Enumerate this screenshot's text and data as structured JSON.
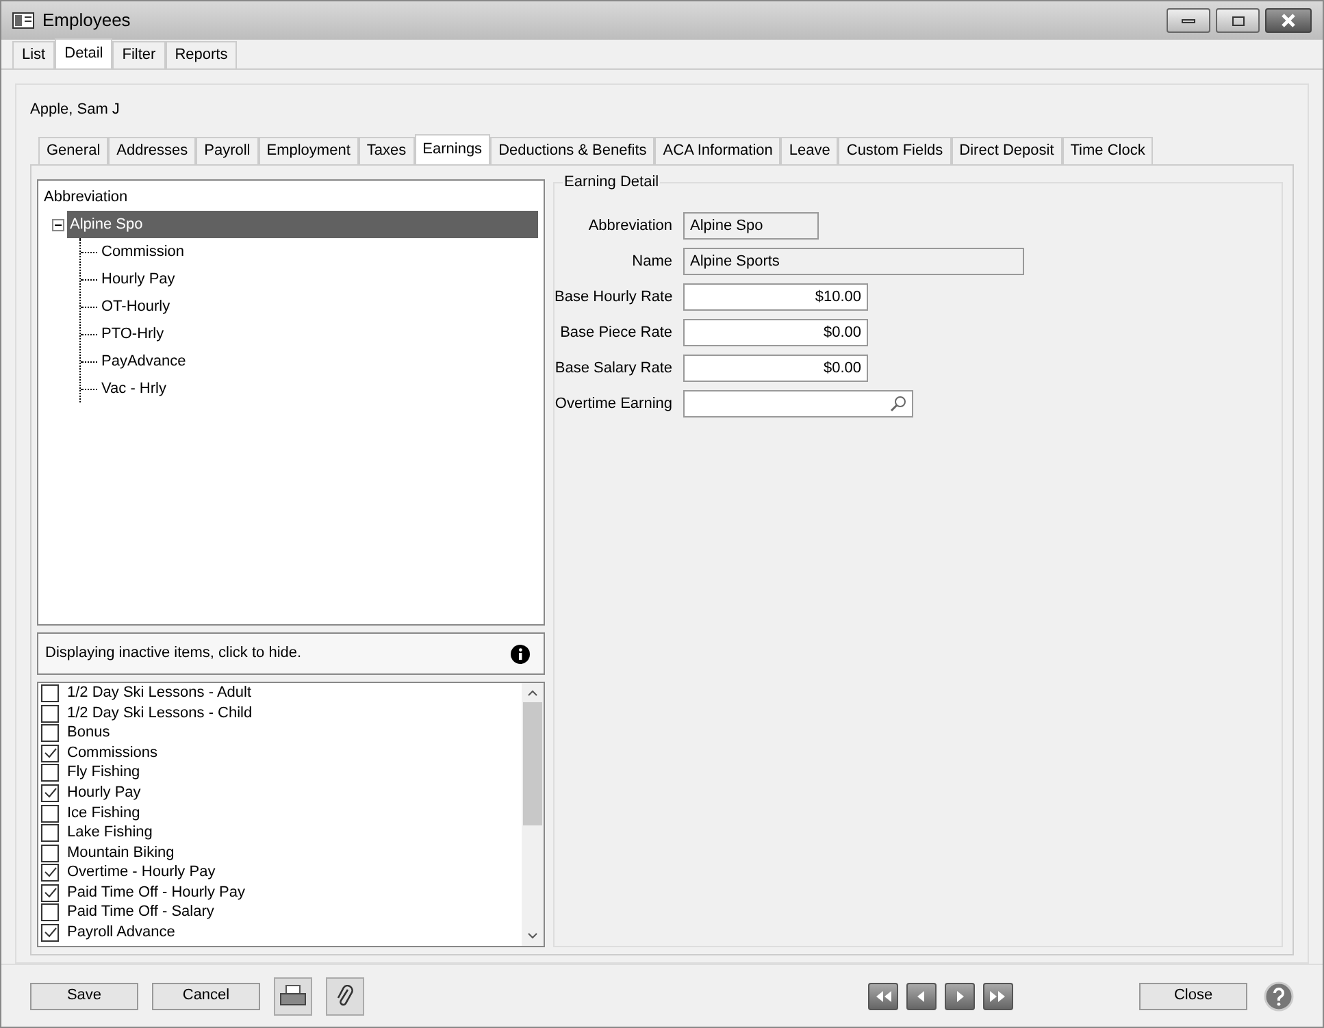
{
  "window": {
    "title": "Employees"
  },
  "tabs": [
    {
      "label": "List",
      "selected": false
    },
    {
      "label": "Detail",
      "selected": true
    },
    {
      "label": "Filter",
      "selected": false
    },
    {
      "label": "Reports",
      "selected": false
    }
  ],
  "employee_name": "Apple, Sam J",
  "detail_tabs": [
    {
      "label": "General",
      "selected": false
    },
    {
      "label": "Addresses",
      "selected": false
    },
    {
      "label": "Payroll",
      "selected": false
    },
    {
      "label": "Employment",
      "selected": false
    },
    {
      "label": "Taxes",
      "selected": false
    },
    {
      "label": "Earnings",
      "selected": true
    },
    {
      "label": "Deductions & Benefits",
      "selected": false
    },
    {
      "label": "ACA Information",
      "selected": false
    },
    {
      "label": "Leave",
      "selected": false
    },
    {
      "label": "Custom Fields",
      "selected": false
    },
    {
      "label": "Direct Deposit",
      "selected": false
    },
    {
      "label": "Time Clock",
      "selected": false
    }
  ],
  "tree": {
    "header": "Abbreviation",
    "items": [
      {
        "label": "Alpine Spo",
        "selected": true,
        "expanded": true,
        "children": [
          {
            "label": "Commission",
            "selected": false
          },
          {
            "label": "Hourly Pay",
            "selected": false
          },
          {
            "label": "OT-Hourly",
            "selected": false
          },
          {
            "label": "PTO-Hrly",
            "selected": false
          },
          {
            "label": "PayAdvance",
            "selected": false
          },
          {
            "label": "Vac - Hrly",
            "selected": false
          }
        ]
      }
    ]
  },
  "inactive_notice": "Displaying inactive items, click to hide.",
  "earnings_list": [
    {
      "label": "1/2 Day Ski Lessons - Adult",
      "checked": false
    },
    {
      "label": "1/2 Day Ski Lessons - Child",
      "checked": false
    },
    {
      "label": "Bonus",
      "checked": false
    },
    {
      "label": "Commissions",
      "checked": true
    },
    {
      "label": "Fly Fishing",
      "checked": false
    },
    {
      "label": "Hourly Pay",
      "checked": true
    },
    {
      "label": "Ice Fishing",
      "checked": false
    },
    {
      "label": "Lake Fishing",
      "checked": false
    },
    {
      "label": "Mountain Biking",
      "checked": false
    },
    {
      "label": "Overtime - Hourly Pay",
      "checked": true
    },
    {
      "label": "Paid Time Off - Hourly Pay",
      "checked": true
    },
    {
      "label": "Paid Time Off - Salary",
      "checked": false
    },
    {
      "label": "Payroll Advance",
      "checked": true
    }
  ],
  "earning_detail": {
    "title": "Earning Detail",
    "fields": [
      {
        "label": "Abbreviation",
        "value": "Alpine Spo",
        "kind": "readonly"
      },
      {
        "label": "Name",
        "value": "Alpine Sports",
        "kind": "readonly"
      },
      {
        "label": "Base Hourly Rate",
        "value": "$10.00",
        "kind": "amount"
      },
      {
        "label": "Base Piece Rate",
        "value": "$0.00",
        "kind": "amount"
      },
      {
        "label": "Base Salary Rate",
        "value": "$0.00",
        "kind": "amount"
      },
      {
        "label": "Overtime Earning",
        "kind": "lookup"
      }
    ]
  },
  "buttons": {
    "save": "Save",
    "cancel": "Cancel",
    "close": "Close"
  }
}
